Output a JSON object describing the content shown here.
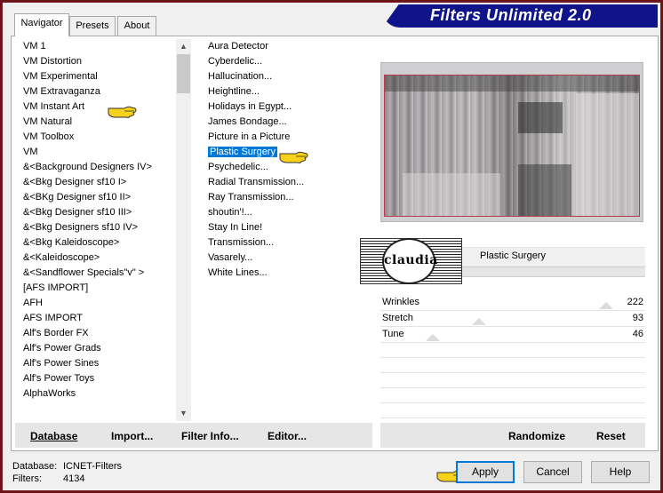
{
  "window": {
    "title": "Filters Unlimited 2.0"
  },
  "tabs": [
    {
      "label": "Navigator",
      "active": true
    },
    {
      "label": "Presets",
      "active": false
    },
    {
      "label": "About",
      "active": false
    }
  ],
  "categories": {
    "items": [
      "VM 1",
      "VM Distortion",
      "VM Experimental",
      "VM Extravaganza",
      "VM Instant Art",
      "VM Natural",
      "VM Toolbox",
      "VM",
      "&<Background Designers IV>",
      "&<Bkg Designer sf10 I>",
      "&<BKg Designer sf10 II>",
      "&<Bkg Designer sf10 III>",
      "&<Bkg Designers sf10 IV>",
      "&<Bkg Kaleidoscope>",
      "&<Kaleidoscope>",
      "&<Sandflower Specials\"v\" >",
      "[AFS IMPORT]",
      "AFH",
      "AFS IMPORT",
      "Alf's Border FX",
      "Alf's Power Grads",
      "Alf's Power Sines",
      "Alf's Power Toys",
      "AlphaWorks"
    ],
    "selected": "VM Extravaganza"
  },
  "filters": {
    "items": [
      "Aura Detector",
      "Cyberdelic...",
      "Hallucination...",
      "Heightline...",
      "Holidays in Egypt...",
      "James Bondage...",
      "Picture in a Picture",
      "Plastic Surgery",
      "Psychedelic...",
      "Radial Transmission...",
      "Ray Transmission...",
      "shoutin'!...",
      "Stay In Line!",
      "Transmission...",
      "Vasarely...",
      "White Lines..."
    ],
    "selected": "Plastic Surgery"
  },
  "preview": {
    "filter_name": "Plastic Surgery",
    "logo_text": "claudia"
  },
  "sliders": [
    {
      "label": "Wrinkles",
      "value": "222",
      "fraction": 0.871
    },
    {
      "label": "Stretch",
      "value": "93",
      "fraction": 0.365
    },
    {
      "label": "Tune",
      "value": "46",
      "fraction": 0.18
    }
  ],
  "toolbar_left": {
    "database": "Database",
    "import": "Import...",
    "filter_info": "Filter Info...",
    "editor": "Editor..."
  },
  "toolbar_right": {
    "randomize": "Randomize",
    "reset": "Reset"
  },
  "footer": {
    "database_label": "Database:",
    "database_value": "ICNET-Filters",
    "filters_label": "Filters:",
    "filters_value": "4134"
  },
  "buttons": {
    "apply": "Apply",
    "cancel": "Cancel",
    "help": "Help"
  },
  "colors": {
    "border": "#6b1418",
    "banner": "#10148a",
    "selection": "#0078d7"
  }
}
